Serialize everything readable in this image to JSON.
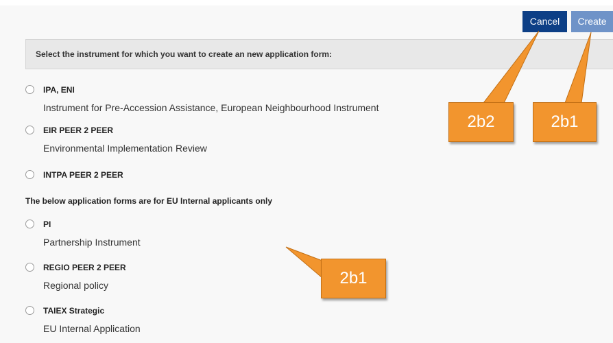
{
  "buttons": {
    "cancel": "Cancel",
    "create": "Create"
  },
  "header": {
    "prompt": "Select the instrument for which you want to create an new application form:"
  },
  "options": [
    {
      "label": "IPA, ENI",
      "description": "Instrument for Pre-Accession Assistance, European Neighbourhood Instrument"
    },
    {
      "label": "EIR PEER 2 PEER",
      "description": "Environmental Implementation Review"
    },
    {
      "label": "INTPA PEER 2 PEER",
      "description": ""
    },
    {
      "label": "PI",
      "description": "Partnership Instrument"
    },
    {
      "label": "REGIO PEER 2 PEER",
      "description": "Regional policy"
    },
    {
      "label": "TAIEX Strategic",
      "description": "EU Internal Application"
    }
  ],
  "internal_note": "The below application forms are for EU Internal applicants only",
  "callouts": {
    "cancel_callout": "2b2",
    "create_callout": "2b1",
    "list_callout": "2b1"
  },
  "colors": {
    "primary": "#0d3f86",
    "create": "#6f93c8",
    "callout": "#f2952e"
  }
}
